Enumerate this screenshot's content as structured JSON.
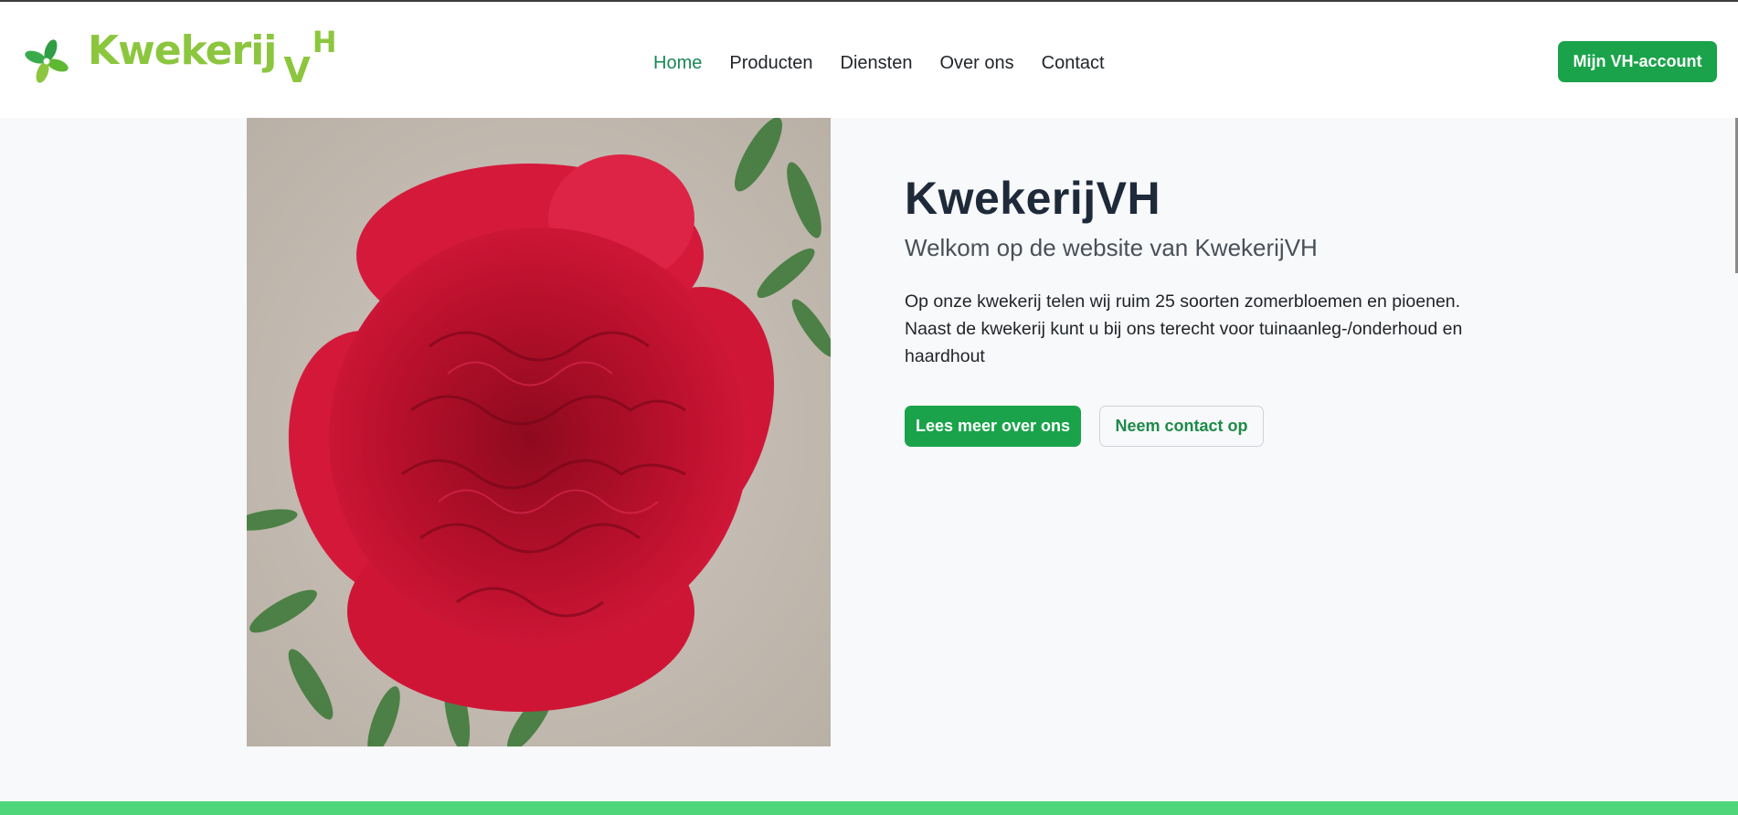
{
  "brand": {
    "logo_icon": "pinwheel-leaf-icon",
    "name": "Kwekerij",
    "v": "V",
    "h": "H",
    "color": "#8cc63f"
  },
  "nav": {
    "items": [
      {
        "label": "Home",
        "active": true
      },
      {
        "label": "Producten",
        "active": false
      },
      {
        "label": "Diensten",
        "active": false
      },
      {
        "label": "Over ons",
        "active": false
      },
      {
        "label": "Contact",
        "active": false
      }
    ]
  },
  "header": {
    "account_button": "Mijn VH-account"
  },
  "hero": {
    "image": "red-peony-photo",
    "title": "KwekerijVH",
    "subtitle": "Welkom op de website van KwekerijVH",
    "body": "Op onze kwekerij telen wij ruim 25 soorten zomerbloemen en pioenen. Naast de kwekerij kunt u bij ons terecht voor tuinaanleg-/onderhoud en haardhout",
    "primary_button": "Lees meer over ons",
    "secondary_button": "Neem contact op"
  },
  "colors": {
    "accent": "#1aa34a",
    "nav_active": "#198754",
    "footer_bar": "#4fd67a",
    "background": "#f8f9fa"
  }
}
